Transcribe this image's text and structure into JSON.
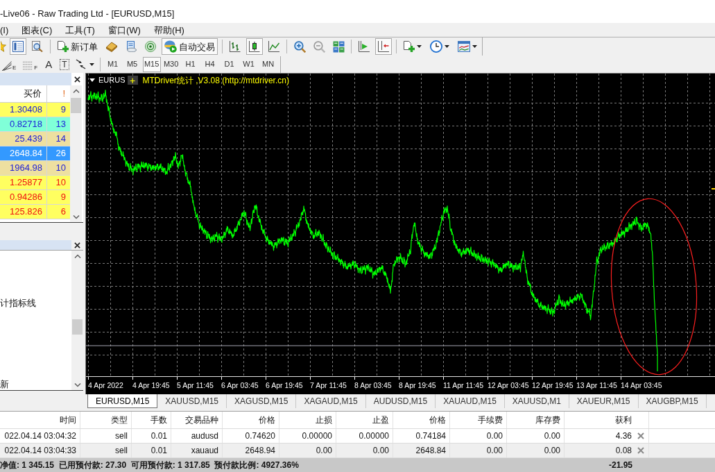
{
  "window": {
    "title": "-Live06 - Raw Trading Ltd - [EURUSD,M15]"
  },
  "menu": [
    "(I)",
    "图表(C)",
    "工具(T)",
    "窗口(W)",
    "帮助(H)"
  ],
  "toolbar": [
    {
      "kind": "star",
      "pressed": false
    },
    {
      "kind": "list",
      "pressed": true
    },
    {
      "kind": "magnifier-doc",
      "pressed": false
    },
    {
      "kind": "separator"
    },
    {
      "kind": "new-order",
      "label": "新订单",
      "pressed": false
    },
    {
      "kind": "editor",
      "pressed": false
    },
    {
      "kind": "terminal",
      "pressed": false
    },
    {
      "kind": "signal",
      "pressed": false
    },
    {
      "kind": "auto-trading",
      "label": "自动交易",
      "pressed": true
    },
    {
      "kind": "separator"
    },
    {
      "kind": "bar-chart",
      "pressed": false
    },
    {
      "kind": "candles",
      "pressed": true
    },
    {
      "kind": "line-chart",
      "pressed": false
    },
    {
      "kind": "separator"
    },
    {
      "kind": "zoom-in",
      "pressed": false
    },
    {
      "kind": "zoom-out",
      "pressed": false
    },
    {
      "kind": "tile",
      "pressed": false
    },
    {
      "kind": "separator"
    },
    {
      "kind": "autoscroll",
      "pressed": false
    },
    {
      "kind": "shift",
      "pressed": true
    },
    {
      "kind": "separator"
    },
    {
      "kind": "indicators",
      "pressed": false,
      "dropdown": true
    },
    {
      "kind": "periods",
      "pressed": false,
      "dropdown": true
    },
    {
      "kind": "templates",
      "pressed": false,
      "dropdown": true
    }
  ],
  "drawing_toolbar": [
    {
      "kind": "fan",
      "label": "E"
    },
    {
      "kind": "levels",
      "label": "F"
    },
    {
      "kind": "text",
      "label": "A"
    },
    {
      "kind": "label",
      "label": "T"
    },
    {
      "kind": "arrows",
      "dropdown": true
    }
  ],
  "timeframes": [
    {
      "label": "M1",
      "selected": false
    },
    {
      "label": "M5",
      "selected": false
    },
    {
      "label": "M15",
      "selected": true
    },
    {
      "label": "M30",
      "selected": false
    },
    {
      "label": "H1",
      "selected": false
    },
    {
      "label": "H4",
      "selected": false
    },
    {
      "label": "D1",
      "selected": false
    },
    {
      "label": "W1",
      "selected": false
    },
    {
      "label": "MN",
      "selected": false
    }
  ],
  "market_watch": {
    "columns": [
      "买价",
      "!"
    ],
    "rows": [
      {
        "bid": "1.30408",
        "ticks": "9",
        "color": "#ffff60",
        "kind": "rising",
        "selected": false
      },
      {
        "bid": "0.82718",
        "ticks": "13",
        "color": "#80ffd8",
        "kind": "rising",
        "selected": false
      },
      {
        "bid": "25.439",
        "ticks": "14",
        "color": "#eee0a0",
        "kind": "rising",
        "selected": false
      },
      {
        "bid": "2648.84",
        "ticks": "26",
        "selected": true
      },
      {
        "bid": "1964.98",
        "ticks": "10",
        "color": "#eee0a0",
        "kind": "rising",
        "selected": false
      },
      {
        "bid": "1.25877",
        "ticks": "10",
        "color": "#ffff60",
        "kind": "falling",
        "selected": false
      },
      {
        "bid": "0.94286",
        "ticks": "9",
        "color": "#ffff60",
        "kind": "falling",
        "selected": false
      },
      {
        "bid": "125.826",
        "ticks": "6",
        "color": "#ffff60",
        "kind": "falling",
        "selected": false
      }
    ]
  },
  "navigator": {
    "items": [
      "计指标线",
      "新"
    ]
  },
  "chart": {
    "symbol": "EURUS",
    "expand_button": "+",
    "indicator_label": "MTDriver统计 ,V3.08 (http://mtdriver.cn)",
    "time_labels": [
      "4 Apr 2022",
      "4 Apr 19:45",
      "5 Apr 11:45",
      "6 Apr 03:45",
      "6 Apr 19:45",
      "7 Apr 11:45",
      "8 Apr 03:45",
      "8 Apr 19:45",
      "11 Apr 11:45",
      "12 Apr 03:45",
      "12 Apr 19:45",
      "13 Apr 11:45",
      "14 Apr 03:45"
    ]
  },
  "chart_tabs": [
    {
      "label": "EURUSD,M15",
      "selected": true
    },
    {
      "label": "XAUUSD,M15",
      "selected": false
    },
    {
      "label": "XAGUSD,M15",
      "selected": false
    },
    {
      "label": "XAGAUD,M15",
      "selected": false
    },
    {
      "label": "AUDUSD,M15",
      "selected": false
    },
    {
      "label": "XAUAUD,M15",
      "selected": false
    },
    {
      "label": "XAUUSD,M1",
      "selected": false
    },
    {
      "label": "XAUEUR,M15",
      "selected": false
    },
    {
      "label": "XAUGBP,M15",
      "selected": false
    }
  ],
  "trade_table": {
    "columns": [
      "时间",
      "类型",
      "手数",
      "交易品种",
      "价格",
      "止损",
      "止盈",
      "价格",
      "手续费",
      "库存费",
      "获利"
    ],
    "rows": [
      [
        "022.04.14 03:04:32",
        "sell",
        "0.01",
        "audusd",
        "0.74620",
        "0.00000",
        "0.00000",
        "0.74184",
        "0.00",
        "0.00",
        "4.36"
      ],
      [
        "022.04.14 03:04:33",
        "sell",
        "0.01",
        "xauaud",
        "2648.94",
        "0.00",
        "0.00",
        "2648.84",
        "0.00",
        "0.00",
        "0.08"
      ]
    ],
    "summary": "净值: 1 345.15  已用预付款: 27.30  可用预付款: 1 317.85  预付款比例: 4927.36%",
    "total_profit": "-21.95"
  }
}
